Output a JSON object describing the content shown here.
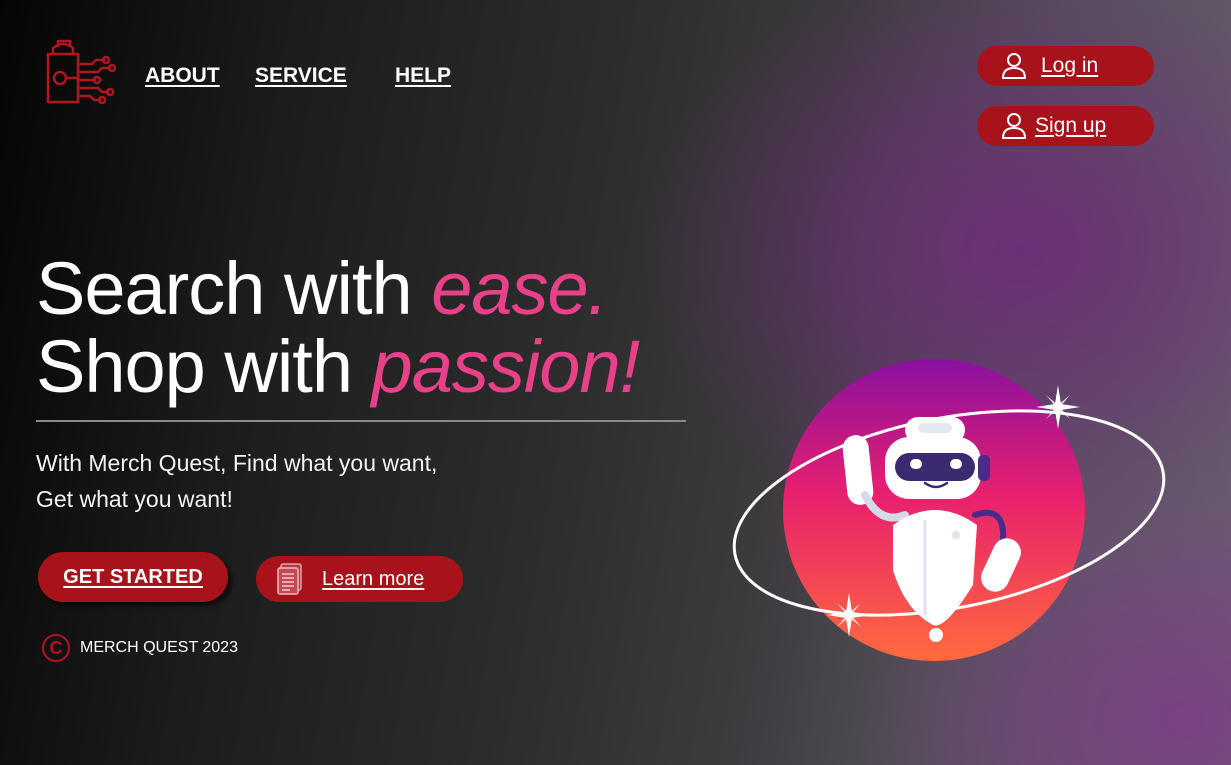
{
  "brand": {
    "logo_icon": "shopping-bag-circuit-icon",
    "accent_color": "#a8121b",
    "highlight_color": "#e8418a"
  },
  "nav": {
    "items": [
      {
        "label": "ABOUT"
      },
      {
        "label": "SERVICE"
      },
      {
        "label": "HELP"
      }
    ]
  },
  "auth": {
    "login_label": "Log in",
    "signup_label": "Sign up",
    "icon": "user-icon"
  },
  "hero": {
    "line1_main": "Search with ",
    "line1_accent": "ease.",
    "line2_main": "Shop with ",
    "line2_accent": "passion!",
    "sub_line1": "With Merch Quest, Find what you want,",
    "sub_line2": "Get what you want!"
  },
  "cta": {
    "get_started_label": "GET STARTED",
    "learn_more_label": "Learn more",
    "learn_more_icon": "document-icon"
  },
  "footer": {
    "copyright_text": "MERCH QUEST 2023",
    "copyright_icon": "copyright-icon"
  },
  "illustration": {
    "subject": "robot-mascot",
    "gradient_top": "#8a10a0",
    "gradient_mid": "#e8206e",
    "gradient_bottom": "#ff6a3d"
  }
}
